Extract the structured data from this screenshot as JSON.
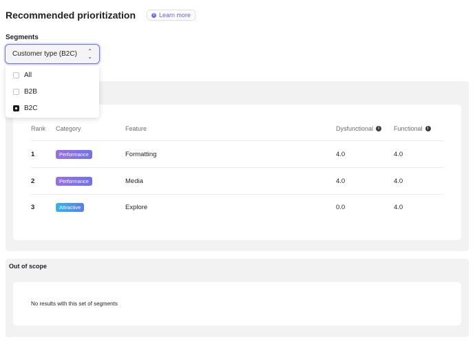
{
  "header": {
    "title": "Recommended prioritization",
    "learn_more": "Learn more",
    "info_icon": "info-icon"
  },
  "segments": {
    "label": "Segments",
    "selected": "Customer type (B2C)",
    "options": [
      {
        "label": "All",
        "checked": false
      },
      {
        "label": "B2B",
        "checked": false
      },
      {
        "label": "B2C",
        "checked": true
      }
    ]
  },
  "table": {
    "columns": {
      "rank": "Rank",
      "category": "Category",
      "feature": "Feature",
      "dysfunctional": "Dysfunctional",
      "functional": "Functional"
    },
    "rows": [
      {
        "rank": "1",
        "category": "Performance",
        "feature": "Formatting",
        "dysfunctional": "4.0",
        "functional": "4.0"
      },
      {
        "rank": "2",
        "category": "Performance",
        "feature": "Media",
        "dysfunctional": "4.0",
        "functional": "4.0"
      },
      {
        "rank": "3",
        "category": "Attractive",
        "feature": "Explore",
        "dysfunctional": "0.0",
        "functional": "4.0"
      }
    ]
  },
  "out_of_scope": {
    "title": "Out of scope",
    "empty_message": "No results with this set of segments"
  },
  "colors": {
    "accent": "#6b73e0",
    "performance_badge": "#8a70e7",
    "attractive_badge": "#3aa6ee",
    "panel_bg": "#f2f2f3"
  }
}
